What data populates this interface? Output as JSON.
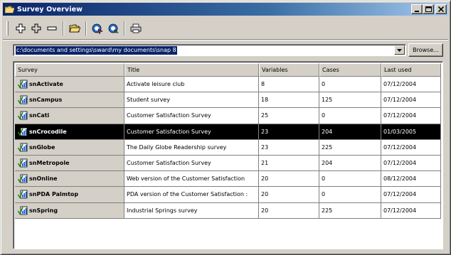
{
  "window": {
    "title": "Survey Overview"
  },
  "toolbar": {
    "buttons": [
      {
        "icon": "add-icon"
      },
      {
        "icon": "add-outline-icon"
      },
      {
        "icon": "remove-icon"
      },
      {
        "icon": "open-folder-icon"
      },
      {
        "icon": "survey-run-icon"
      },
      {
        "icon": "survey-refresh-icon"
      },
      {
        "icon": "print-icon"
      }
    ]
  },
  "path": {
    "value": "c:\\documents and settings\\sward\\my documents\\snap 8",
    "browse_label": "Browse..."
  },
  "table": {
    "columns": [
      "Survey",
      "Title",
      "Variables",
      "Cases",
      "Last used"
    ],
    "rows": [
      {
        "survey": "snActivate",
        "title": "Activate leisure club",
        "variables": "8",
        "cases": "0",
        "last_used": "07/12/2004",
        "selected": false
      },
      {
        "survey": "snCampus",
        "title": "Student survey",
        "variables": "18",
        "cases": "125",
        "last_used": "07/12/2004",
        "selected": false
      },
      {
        "survey": "snCati",
        "title": "Customer Satisfaction Survey",
        "variables": "25",
        "cases": "0",
        "last_used": "07/12/2004",
        "selected": false
      },
      {
        "survey": "snCrocodile",
        "title": "Customer Satisfaction Survey",
        "variables": "23",
        "cases": "204",
        "last_used": "01/03/2005",
        "selected": true
      },
      {
        "survey": "snGlobe",
        "title": "The Daily Globe Readership survey",
        "variables": "23",
        "cases": "225",
        "last_used": "07/12/2004",
        "selected": false
      },
      {
        "survey": "snMetropole",
        "title": "Customer Satisfaction Survey",
        "variables": "21",
        "cases": "204",
        "last_used": "07/12/2004",
        "selected": false
      },
      {
        "survey": "snOnline",
        "title": "Web version of the Customer Satisfaction",
        "variables": "20",
        "cases": "0",
        "last_used": "08/12/2004",
        "selected": false
      },
      {
        "survey": "snPDA Palmtop",
        "title": "PDA version of the Customer Satisfaction :",
        "variables": "20",
        "cases": "0",
        "last_used": "07/12/2004",
        "selected": false
      },
      {
        "survey": "snSpring",
        "title": "Industrial Springs survey",
        "variables": "20",
        "cases": "225",
        "last_used": "07/12/2004",
        "selected": false
      }
    ]
  },
  "colors": {
    "title_bar": "#0a246a",
    "face": "#d4d0c8",
    "selection": "#000000",
    "path_highlight": "#0a246a"
  }
}
